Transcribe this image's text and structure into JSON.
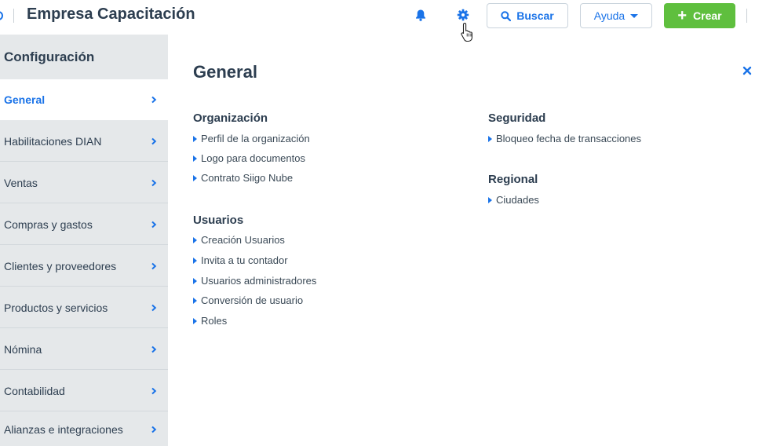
{
  "header": {
    "app_title": "Empresa Capacitación",
    "buscar_label": "Buscar",
    "ayuda_label": "Ayuda",
    "crear_label": "Crear"
  },
  "colors": {
    "accent": "#1a73e8",
    "create_green": "#5fbf3e",
    "sidebar_bg": "#e5e8ea",
    "text_dark": "#2d3e50"
  },
  "sidebar": {
    "title": "Configuración",
    "items": [
      {
        "label": "General",
        "active": true
      },
      {
        "label": "Habilitaciones DIAN",
        "active": false
      },
      {
        "label": "Ventas",
        "active": false
      },
      {
        "label": "Compras y gastos",
        "active": false
      },
      {
        "label": "Clientes y proveedores",
        "active": false
      },
      {
        "label": "Productos y servicios",
        "active": false
      },
      {
        "label": "Nómina",
        "active": false
      },
      {
        "label": "Contabilidad",
        "active": false
      },
      {
        "label": "Alianzas e integraciones",
        "active": false
      }
    ]
  },
  "main": {
    "title": "General",
    "sections": {
      "organizacion": {
        "heading": "Organización",
        "links": [
          "Perfil de la organización",
          "Logo para documentos",
          "Contrato Siigo Nube"
        ]
      },
      "usuarios": {
        "heading": "Usuarios",
        "links": [
          "Creación Usuarios",
          "Invita a tu contador",
          "Usuarios administradores",
          "Conversión de usuario",
          "Roles"
        ]
      },
      "seguridad": {
        "heading": "Seguridad",
        "links": [
          "Bloqueo fecha de transacciones"
        ]
      },
      "regional": {
        "heading": "Regional",
        "links": [
          "Ciudades"
        ]
      }
    }
  },
  "icons": [
    "bell-icon",
    "gear-icon",
    "search-icon",
    "chevron-right-icon",
    "close-icon",
    "plus-icon",
    "pointer-cursor-icon"
  ]
}
